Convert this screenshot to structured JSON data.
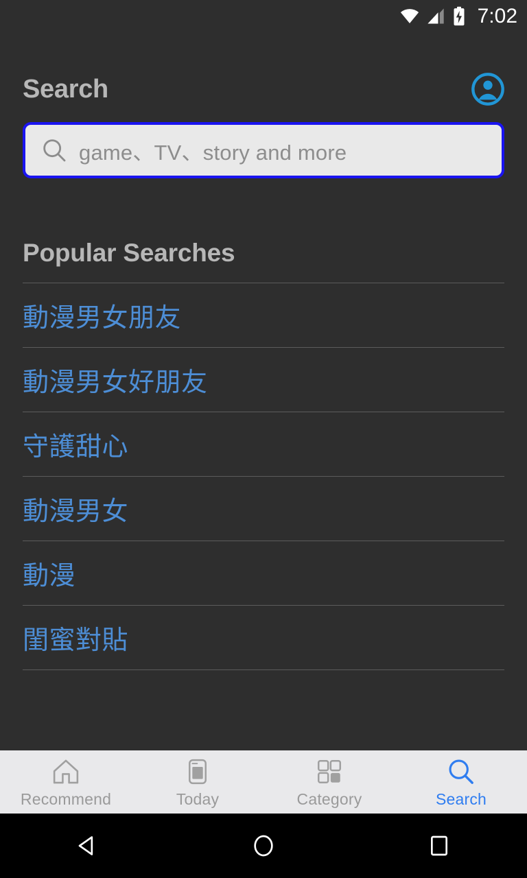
{
  "status_bar": {
    "time": "7:02",
    "icons": [
      "wifi-icon",
      "cellular-signal-icon",
      "battery-charging-icon"
    ]
  },
  "header": {
    "title": "Search",
    "avatar_icon": "account-circle-icon"
  },
  "search": {
    "placeholder": "game、TV、story and more",
    "value": "",
    "icon": "search-icon",
    "border_color": "#1a14f0",
    "background_color": "#e9e9e9"
  },
  "popular": {
    "title": "Popular Searches",
    "terms": [
      "動漫男女朋友",
      "動漫男女好朋友",
      "守護甜心",
      "動漫男女",
      "動漫",
      "閨蜜對貼"
    ],
    "link_color": "#4d8ed6"
  },
  "tabbar": {
    "active_color": "#2f7df0",
    "inactive_color": "#9a9a9a",
    "items": [
      {
        "label": "Recommend",
        "icon": "home-icon",
        "active": false
      },
      {
        "label": "Today",
        "icon": "device-card-icon",
        "active": false
      },
      {
        "label": "Category",
        "icon": "grid-squares-icon",
        "active": false
      },
      {
        "label": "Search",
        "icon": "search-icon",
        "active": true
      }
    ]
  },
  "system_nav": {
    "back": "back-triangle-icon",
    "home": "home-circle-icon",
    "recents": "recents-square-icon"
  }
}
